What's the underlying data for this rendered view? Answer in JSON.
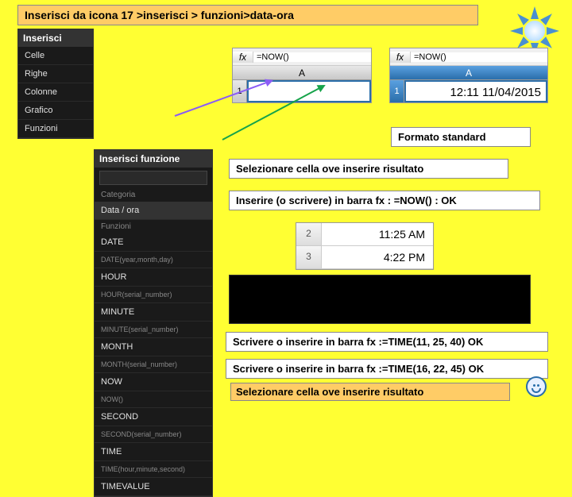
{
  "banner_top": "Inserisci  da icona 17 >inserisci > funzioni>data-ora",
  "menu1": {
    "title": "Inserisci",
    "items": [
      "Celle",
      "Righe",
      "Colonne",
      "Grafico",
      "Funzioni"
    ]
  },
  "menu2": {
    "title": "Inserisci funzione",
    "cat_label": "Categoria",
    "category": "Data / ora",
    "func_label": "Funzioni",
    "funcs": [
      "DATE",
      "DATE(year,month,day)",
      "HOUR",
      "HOUR(serial_number)",
      "MINUTE",
      "MINUTE(serial_number)",
      "MONTH",
      "MONTH(serial_number)",
      "NOW",
      "NOW()",
      "SECOND",
      "SECOND(serial_number)",
      "TIME",
      "TIME(hour,minute,second)",
      "TIMEVALUE"
    ]
  },
  "fxA": {
    "formula": "=NOW()",
    "col": "A",
    "row": "1",
    "value": ""
  },
  "fxB": {
    "formula": "=NOW()",
    "col": "A",
    "row": "1",
    "value": "12:11 11/04/2015"
  },
  "label_formatostd": "Formato standard",
  "label_selez": "Selezionare cella ove inserire risultato",
  "label_inserire": "Inserire (o scrivere) in barra fx : =NOW() : OK",
  "time_examples": {
    "r1_num": "2",
    "r1_val": "11:25 AM",
    "r2_num": "3",
    "r2_val": "4:22 PM"
  },
  "label_time1": "Scrivere o inserire in barra fx :=TIME(11, 25, 40)  OK",
  "label_time2": "Scrivere o inserire in barra fx :=TIME(16, 22, 45)  OK",
  "label_selez2": "Selezionare cella ove inserire risultato"
}
